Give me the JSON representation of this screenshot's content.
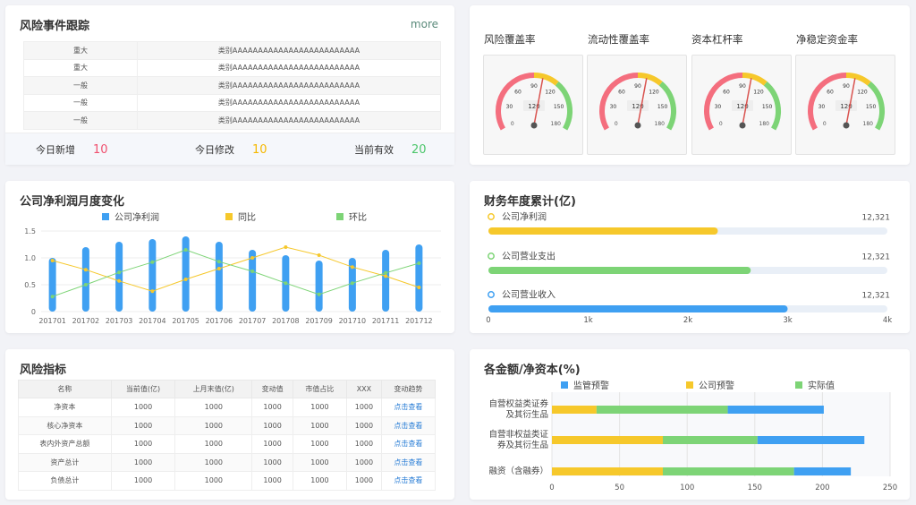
{
  "risk_events": {
    "title": "风险事件跟踪",
    "more": "more",
    "rows": [
      {
        "level": "重大",
        "category": "类别AAAAAAAAAAAAAAAAAAAAAAAAA"
      },
      {
        "level": "重大",
        "category": "类别AAAAAAAAAAAAAAAAAAAAAAAAA"
      },
      {
        "level": "一般",
        "category": "类别AAAAAAAAAAAAAAAAAAAAAAAAA"
      },
      {
        "level": "一般",
        "category": "类别AAAAAAAAAAAAAAAAAAAAAAAAA"
      },
      {
        "level": "一般",
        "category": "类别AAAAAAAAAAAAAAAAAAAAAAAAA"
      }
    ],
    "stats": [
      {
        "label": "今日新增",
        "value": "10",
        "color": "#f0506e"
      },
      {
        "label": "今日修改",
        "value": "10",
        "color": "#f5b800"
      },
      {
        "label": "当前有效",
        "value": "20",
        "color": "#4cc66b"
      }
    ]
  },
  "gauges": [
    {
      "title": "风险覆盖率",
      "value": "120"
    },
    {
      "title": "流动性覆盖率",
      "value": "120"
    },
    {
      "title": "资本杠杆率",
      "value": "120"
    },
    {
      "title": "净稳定资金率",
      "value": "120"
    }
  ],
  "gauge_scale": [
    "0",
    "30",
    "60",
    "90",
    "120",
    "150",
    "180"
  ],
  "gauge_colors": {
    "low": "#f46e7e",
    "mid": "#f6c82b",
    "high": "#7dd476"
  },
  "chart_data": [
    {
      "type": "bar",
      "title": "公司净利润月度变化",
      "categories": [
        "201701",
        "201702",
        "201703",
        "201704",
        "201705",
        "201706",
        "201707",
        "201708",
        "201709",
        "201710",
        "201711",
        "201712"
      ],
      "ylim": [
        0,
        1.5
      ],
      "yticks": [
        "0",
        "0.5",
        "1.0",
        "1.5"
      ],
      "series": [
        {
          "name": "公司净利润",
          "kind": "bar",
          "color": "#3fa0f2",
          "values": [
            1.0,
            1.2,
            1.3,
            1.35,
            1.4,
            1.3,
            1.15,
            1.05,
            0.95,
            1.0,
            1.15,
            1.25
          ]
        },
        {
          "name": "同比",
          "kind": "line",
          "color": "#f6c82b",
          "values": [
            0.95,
            0.78,
            0.57,
            0.38,
            0.6,
            0.8,
            1.0,
            1.2,
            1.05,
            0.83,
            0.66,
            0.45
          ]
        },
        {
          "name": "环比",
          "kind": "line",
          "color": "#7dd476",
          "values": [
            0.28,
            0.5,
            0.73,
            0.92,
            1.15,
            0.93,
            0.75,
            0.53,
            0.32,
            0.53,
            0.72,
            0.9
          ]
        }
      ]
    },
    {
      "type": "bar",
      "title": "财务年度累计(亿)",
      "xlim": [
        0,
        4000
      ],
      "xticks": [
        "0",
        "1k",
        "2k",
        "3k",
        "4k"
      ],
      "bars": [
        {
          "name": "公司净利润",
          "label": "12,321",
          "value": 2300,
          "color": "#f6c82b"
        },
        {
          "name": "公司营业支出",
          "label": "12,321",
          "value": 2630,
          "color": "#7dd476"
        },
        {
          "name": "公司营业收入",
          "label": "12,321",
          "value": 3000,
          "color": "#3fa0f2"
        }
      ]
    },
    {
      "type": "bar",
      "title": "各金额/净资本(%)",
      "xlim": [
        0,
        250
      ],
      "xticks": [
        "0",
        "50",
        "100",
        "150",
        "200",
        "250"
      ],
      "legend": [
        {
          "name": "监管预警",
          "color": "#3fa0f2"
        },
        {
          "name": "公司预警",
          "color": "#f6c82b"
        },
        {
          "name": "实际值",
          "color": "#7dd476"
        }
      ],
      "categories": [
        [
          "自营权益类证券",
          "及其衍生品"
        ],
        [
          "自营非权益类证",
          "券及其衍生品"
        ],
        [
          "融资（含融券）"
        ]
      ],
      "segments": [
        [
          {
            "value": 33,
            "color": "#f6c82b"
          },
          {
            "value": 97,
            "color": "#7dd476"
          },
          {
            "value": 71,
            "color": "#3fa0f2"
          }
        ],
        [
          {
            "value": 82,
            "color": "#f6c82b"
          },
          {
            "value": 70,
            "color": "#7dd476"
          },
          {
            "value": 79,
            "color": "#3fa0f2"
          }
        ],
        [
          {
            "value": 82,
            "color": "#f6c82b"
          },
          {
            "value": 97,
            "color": "#7dd476"
          },
          {
            "value": 42,
            "color": "#3fa0f2"
          }
        ]
      ]
    }
  ],
  "risk_indicators": {
    "title": "风险指标",
    "headers": [
      "名称",
      "当前值(亿)",
      "上月末值(亿)",
      "变动值",
      "市值占比",
      "XXX",
      "变动趋势"
    ],
    "link_label": "点击查看",
    "rows": [
      [
        "净资本",
        "1000",
        "1000",
        "1000",
        "1000",
        "1000"
      ],
      [
        "核心净资本",
        "1000",
        "1000",
        "1000",
        "1000",
        "1000"
      ],
      [
        "表内外资产总额",
        "1000",
        "1000",
        "1000",
        "1000",
        "1000"
      ],
      [
        "资产总计",
        "1000",
        "1000",
        "1000",
        "1000",
        "1000"
      ],
      [
        "负债总计",
        "1000",
        "1000",
        "1000",
        "1000",
        "1000"
      ]
    ]
  }
}
